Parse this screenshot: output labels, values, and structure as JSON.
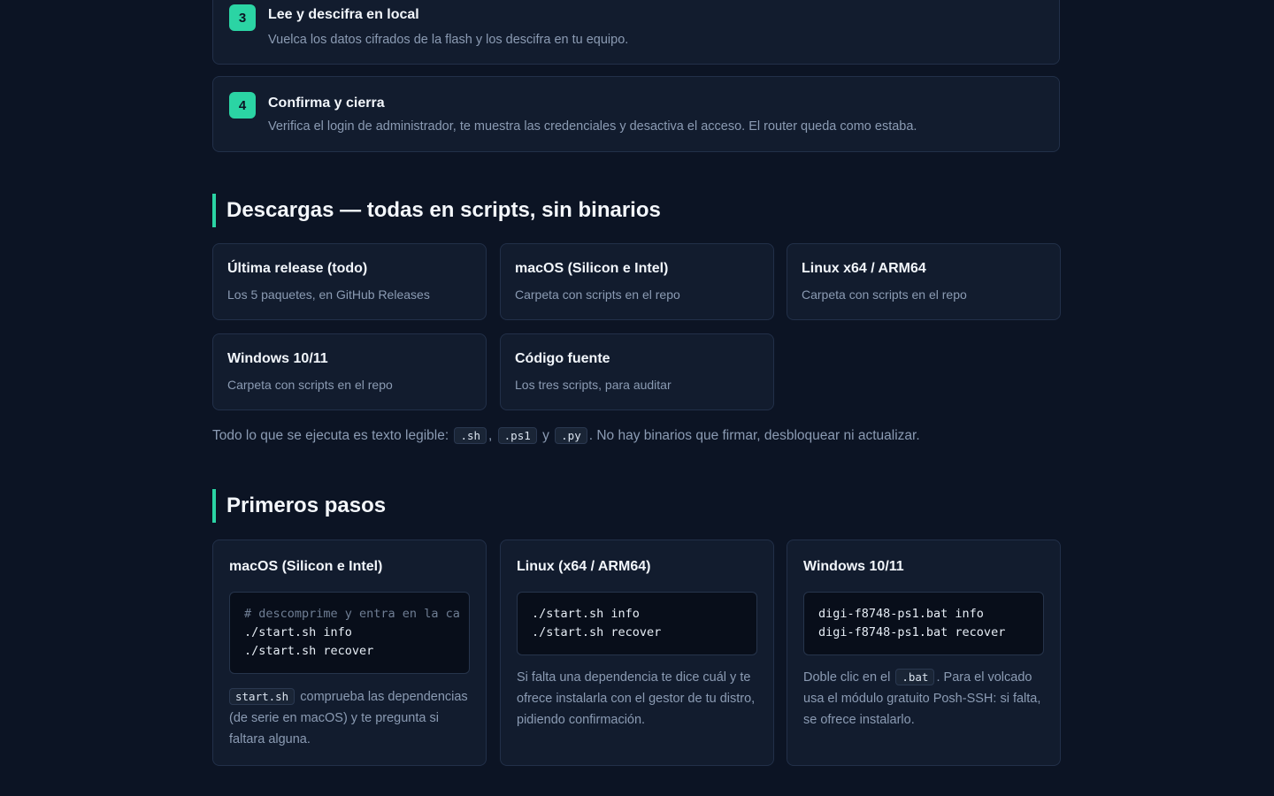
{
  "steps": [
    {
      "num": "3",
      "title": "Lee y descifra en local",
      "desc": "Vuelca los datos cifrados de la flash y los descifra en tu equipo."
    },
    {
      "num": "4",
      "title": "Confirma y cierra",
      "desc": "Verifica el login de administrador, te muestra las credenciales y desactiva el acceso. El router queda como estaba."
    }
  ],
  "downloads": {
    "heading": "Descargas — todas en scripts, sin binarios",
    "cards": [
      {
        "title": "Última release (todo)",
        "sub": "Los 5 paquetes, en GitHub Releases"
      },
      {
        "title": "macOS (Silicon e Intel)",
        "sub": "Carpeta con scripts en el repo"
      },
      {
        "title": "Linux x64 / ARM64",
        "sub": "Carpeta con scripts en el repo"
      },
      {
        "title": "Windows 10/11",
        "sub": "Carpeta con scripts en el repo"
      },
      {
        "title": "Código fuente",
        "sub": "Los tres scripts, para auditar"
      }
    ],
    "note": {
      "prefix": "Todo lo que se ejecuta es texto legible:",
      "code1": ".sh",
      "sep1": ",",
      "code2": ".ps1",
      "sep2": "y",
      "code3": ".py",
      "suffix": ". No hay binarios que firmar, desbloquear ni actualizar."
    }
  },
  "getting_started": {
    "heading": "Primeros pasos",
    "cards": [
      {
        "title": "macOS (Silicon e Intel)",
        "comment": "# descomprime y entra en la ca",
        "lines": [
          "./start.sh info",
          "./start.sh recover"
        ],
        "desc_code": "start.sh",
        "desc": "comprueba las dependencias (de serie en macOS) y te pregunta si faltara alguna."
      },
      {
        "title": "Linux (x64 / ARM64)",
        "lines": [
          "./start.sh info",
          "./start.sh recover"
        ],
        "desc": "Si falta una dependencia te dice cuál y te ofrece instalarla con el gestor de tu distro, pidiendo confirmación."
      },
      {
        "title": "Windows 10/11",
        "lines": [
          "digi-f8748-ps1.bat info",
          "digi-f8748-ps1.bat recover"
        ],
        "desc_prefix": "Doble clic en el",
        "desc_code": ".bat",
        "desc": ". Para el volcado usa el módulo gratuito Posh-SSH: si falta, se ofrece instalarlo."
      }
    ]
  },
  "colors": {
    "accent": "#2bd4a4",
    "background": "#0c1424",
    "card": "#121c2e",
    "muted": "#8b9bb3"
  }
}
